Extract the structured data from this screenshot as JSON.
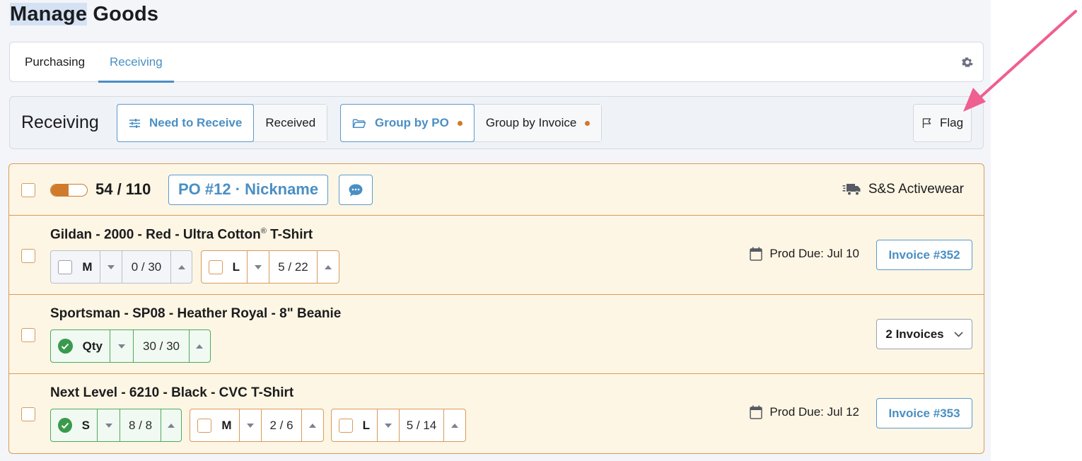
{
  "page": {
    "title_highlighted": "Manage",
    "title_rest": " Goods"
  },
  "tabs": [
    {
      "label": "Purchasing",
      "active": false
    },
    {
      "label": "Receiving",
      "active": true
    }
  ],
  "toolbar": {
    "title": "Receiving",
    "filter": [
      {
        "label": "Need to Receive",
        "active": true,
        "icon": "sliders-icon"
      },
      {
        "label": "Received",
        "active": false
      }
    ],
    "grouping": [
      {
        "label": "Group by PO",
        "active": true,
        "icon": "folder-icon"
      },
      {
        "label": "Group by Invoice",
        "active": false
      }
    ],
    "flag_label": "Flag"
  },
  "po": {
    "received": 54,
    "total": 110,
    "count_text": "54 / 110",
    "tag": "PO #12 · Nickname",
    "vendor": "S&S Activewear",
    "progress_fraction": 0.49,
    "lines": [
      {
        "title": "Gildan - 2000 - Red - Ultra Cotton",
        "title_sup": "®",
        "title_after": " T-Shirt",
        "sizes": [
          {
            "label": "M",
            "qty": "0 / 30",
            "state": "neutral"
          },
          {
            "label": "L",
            "qty": "5 / 22",
            "state": "partial"
          }
        ],
        "due": "Prod Due: Jul 10",
        "invoice": "Invoice #352"
      },
      {
        "title": "Sportsman - SP08 - Heather Royal - 8\" Beanie",
        "sizes": [
          {
            "label": "Qty",
            "qty": "30 / 30",
            "state": "done"
          }
        ],
        "invoice_dropdown": "2 Invoices"
      },
      {
        "title": "Next Level - 6210 - Black - CVC T-Shirt",
        "sizes": [
          {
            "label": "S",
            "qty": "8 / 8",
            "state": "done"
          },
          {
            "label": "M",
            "qty": "2 / 6",
            "state": "partial"
          },
          {
            "label": "L",
            "qty": "5 / 14",
            "state": "partial"
          }
        ],
        "due": "Prod Due: Jul 12",
        "invoice": "Invoice #353"
      }
    ]
  },
  "colors": {
    "accent_blue": "#4a8fc4",
    "po_border": "#d99b5a",
    "po_background": "#fdf6e4",
    "progress_orange": "#d07a2c",
    "done_green": "#3a9a4c",
    "annotation_arrow": "#ef5f8f"
  }
}
